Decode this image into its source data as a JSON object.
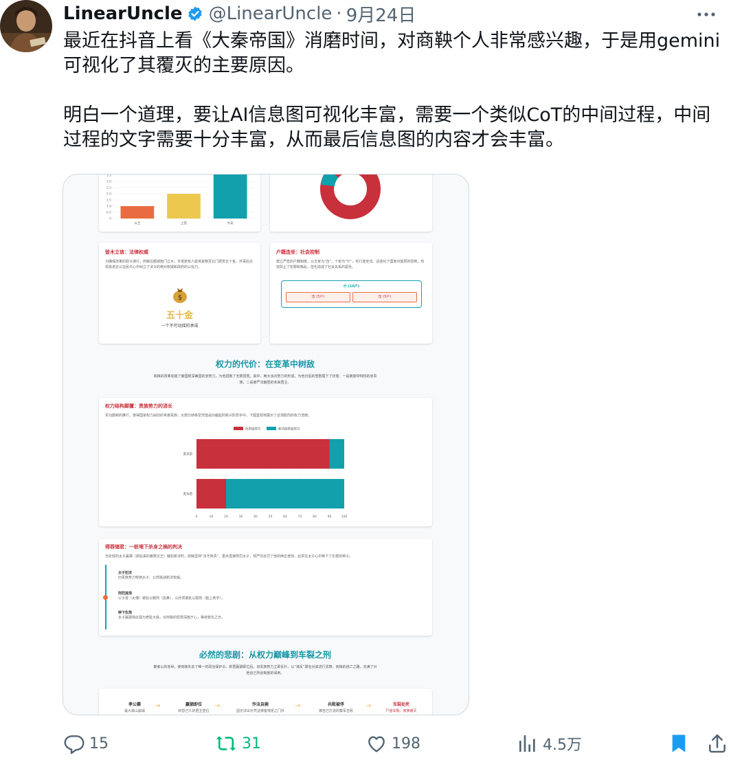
{
  "tweet": {
    "author_name": "LinearUncle",
    "handle": "@LinearUncle",
    "separator": "·",
    "date": "9月24日",
    "text_p1": "最近在抖音上看《大秦帝国》消磨时间，对商鞅个人非常感兴趣，于是用gemini可视化了其覆灭的主要原因。",
    "text_p2": "明白一个道理，要让AI信息图可视化丰富，需要一个类似CoT的中间过程，中间过程的文字需要十分丰富，从而最后信息图的内容才会丰富。"
  },
  "actions": {
    "replies": "15",
    "retweets": "31",
    "likes": "198",
    "views": "4.5万"
  },
  "icons": {
    "verified": "verified-badge-icon",
    "more": "more-icon",
    "reply": "reply-icon",
    "retweet": "retweet-icon",
    "like": "heart-icon",
    "views": "views-icon",
    "bookmark": "bookmark-icon",
    "share": "share-icon",
    "moneybag": "moneybag-icon"
  },
  "colors": {
    "retweet_green": "#00ba7c",
    "bookmark_blue": "#1d9bf0",
    "infographic_red": "#c8303b",
    "infographic_teal": "#12a0ad",
    "gold": "#e8b84b"
  },
  "infographic": {
    "chart1": {
      "type": "bar",
      "categories": [
        "公士",
        "上造",
        "大夫"
      ],
      "values": [
        1.0,
        2.0,
        4.0
      ],
      "colors": [
        "#e96c40",
        "#edc84f",
        "#12a0ad"
      ],
      "ylim": [
        0,
        4.0
      ],
      "yticks": [
        "4.0",
        "3.5",
        "3.0",
        "2.5",
        "2.0",
        "1.5",
        "1.0",
        "0.5",
        "0"
      ]
    },
    "card_law": {
      "title": "徙木立信：法律权威",
      "desc": "为确保改革的政令通行，商鞅在都城南门立木，许诺若有人能将其移至北门便赏五十金，并事后兑现其诺言以在民众心中树立了法令的绝对权威和政府的公信力。",
      "amount": "五十金",
      "caption": "一个不可动摇的承诺"
    },
    "card_household": {
      "title": "户籍连坐：社会控制",
      "desc": "建立严密的户籍制度，以五家为“伍”，十家为“什”，实行连坐法。这强化了国家对基层的控制，有效防止了犯罪和叛乱，但也造成了社会关系的紧张。",
      "shi_label": "什 (10户)",
      "wu_left": "伍 (5户)",
      "wu_right": "伍 (5户)"
    },
    "section1": {
      "title": "权力的代价：在变革中树敌",
      "desc": "商鞅的改革动摇了秦国根深蒂固的旧势力，为他招致了无数怨恨。其中，两大派对势力的形成，为他日后的悲剧埋下了伏笔：一是被剥夺特权的旧贵族，二是被严法触怒的未来君主。"
    },
    "chart2": {
      "type": "bar",
      "title": "权力结构颠覆：贵族势力的消长",
      "desc": "军功爵制的推行，使得国家权力由旧的世袭贵族，大部分转移至凭借战功崛起的新兴阶层手中。下图直观地展示了这场剧烈的权力洗牌。",
      "legend": [
        "旧贵族势力",
        "新功勋贵族势力"
      ],
      "categories": [
        "变法前",
        "变法后"
      ],
      "series": [
        {
          "name": "旧贵族势力",
          "values": [
            90,
            20
          ],
          "color": "#c8303b"
        },
        {
          "name": "新功勋贵族势力",
          "values": [
            10,
            80
          ],
          "color": "#12a0ad"
        }
      ],
      "xlim": [
        0,
        100
      ],
      "xticks": [
        "0",
        "10",
        "20",
        "30",
        "40",
        "50",
        "60",
        "70",
        "80",
        "90",
        "100"
      ]
    },
    "card_prince": {
      "title": "得罪储君：一桩埋下杀身之祸的判决",
      "desc": "当年轻的太子嬴驷（即后来的秦惠文王）触犯新法时，商鞅坚持“法不阿贵”，虽未直接刑罚太子，却严厉处罚了他的两位老师。此举在太子心中种下了仇恨的种子。",
      "items": [
        {
          "title": "太子犯法",
          "desc": "旧贵族势力唆使太子，公然挑战新法权威。"
        },
        {
          "title": "刑罚其师",
          "desc": "公子虔（太傅）被处以劓刑（割鼻），公孙贾被处以黥刑（脸上刺字）。"
        },
        {
          "title": "种下仇恨",
          "desc": "太子嬴驷将此视为奇耻大辱，对商鞅的怨恨深植于心，等待复仇之日。"
        }
      ]
    },
    "section2": {
      "title": "必然的悲剧：从权力巅峰到车裂之刑",
      "desc": "秦孝公的逝世，使商鞅失去了唯一的政治保护伞。新君嬴驷即位后，旧贵族势力立即反扑，以“谋反”罪名对其进行清算。商鞅的逃亡之路，充满了对他自己所创制度的讽刺。"
    },
    "timeline": [
      {
        "title": "孝公薨",
        "desc": "最大靠山崩塌",
        "color": "#333333"
      },
      {
        "title": "嬴驷即位",
        "desc": "积怨已久的君主登位",
        "color": "#333333"
      },
      {
        "title": "作法自毙",
        "desc": "因无法出示凭证被客栈拒之门外",
        "color": "#333333"
      },
      {
        "title": "兵败被俘",
        "desc": "被自己打造的秦军击败",
        "color": "#333333"
      },
      {
        "title": "车裂处死",
        "desc": "尸首车裂，家族被灭",
        "color": "#c8303b"
      }
    ]
  }
}
